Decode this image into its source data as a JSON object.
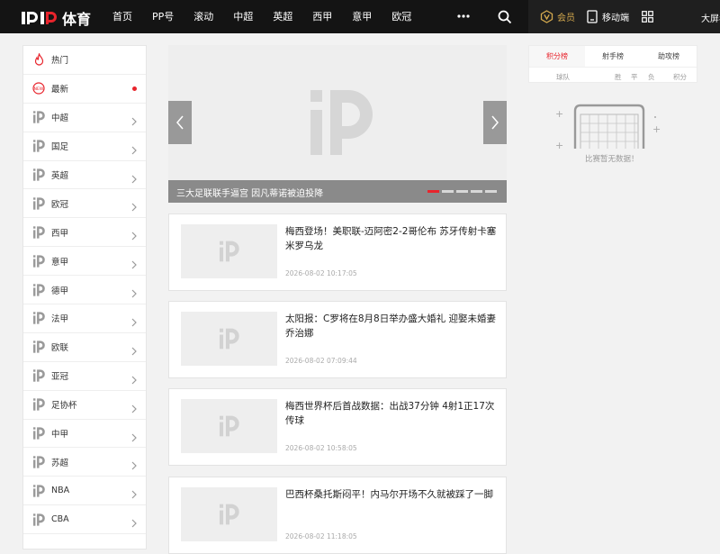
{
  "header": {
    "logo_text": "体育",
    "nav": [
      "首页",
      "PP号",
      "滚动",
      "中超",
      "英超",
      "西甲",
      "意甲",
      "欧冠"
    ],
    "vip_label": "会员",
    "mobile_label": "移动端",
    "bigscreen_label": "大屏看",
    "more_icon": "more-icon",
    "search_icon": "search-icon"
  },
  "sidebar": {
    "items": [
      {
        "label": "热门",
        "icon": "fire-icon",
        "badge": false
      },
      {
        "label": "最新",
        "icon": "new-icon",
        "badge": true
      },
      {
        "label": "中超",
        "icon": "pp-icon",
        "badge": false
      },
      {
        "label": "国足",
        "icon": "pp-icon",
        "badge": false
      },
      {
        "label": "英超",
        "icon": "pp-icon",
        "badge": false
      },
      {
        "label": "欧冠",
        "icon": "pp-icon",
        "badge": false
      },
      {
        "label": "西甲",
        "icon": "pp-icon",
        "badge": false
      },
      {
        "label": "意甲",
        "icon": "pp-icon",
        "badge": false
      },
      {
        "label": "德甲",
        "icon": "pp-icon",
        "badge": false
      },
      {
        "label": "法甲",
        "icon": "pp-icon",
        "badge": false
      },
      {
        "label": "欧联",
        "icon": "pp-icon",
        "badge": false
      },
      {
        "label": "亚冠",
        "icon": "pp-icon",
        "badge": false
      },
      {
        "label": "足协杯",
        "icon": "pp-icon",
        "badge": false
      },
      {
        "label": "中甲",
        "icon": "pp-icon",
        "badge": false
      },
      {
        "label": "苏超",
        "icon": "pp-icon",
        "badge": false
      },
      {
        "label": "NBA",
        "icon": "pp-icon",
        "badge": false
      },
      {
        "label": "CBA",
        "icon": "pp-icon",
        "badge": false
      }
    ]
  },
  "carousel": {
    "caption": "三大足联联手逼宫 因凡蒂诺被迫投降",
    "slide_count": 5,
    "active_slide": 1
  },
  "news": [
    {
      "title": "梅西登场！美职联-迈阿密2-2哥伦布 苏牙传射卡塞米罗乌龙",
      "time": "2026-08-02 10:17:05"
    },
    {
      "title": "太阳报：C罗将在8月8日举办盛大婚礼 迎娶未婚妻乔治娜",
      "time": "2026-08-02 07:09:44"
    },
    {
      "title": "梅西世界杯后首战数据：出战37分钟 4射1正17次传球",
      "time": "2026-08-02 10:58:05"
    },
    {
      "title": "巴西杯桑托斯闷平！内马尔开场不久就被踩了一脚",
      "time": "2026-08-02 11:18:05"
    }
  ],
  "standings": {
    "tabs": [
      "积分榜",
      "射手榜",
      "助攻榜"
    ],
    "active_tab": 0,
    "columns": [
      "球队",
      "胜",
      "平",
      "负",
      "积分"
    ],
    "empty_text": "比赛暂无数据！"
  },
  "colors": {
    "accent": "#e8242c",
    "vip_gold": "#d4a94e",
    "header_bg": "#141414"
  }
}
